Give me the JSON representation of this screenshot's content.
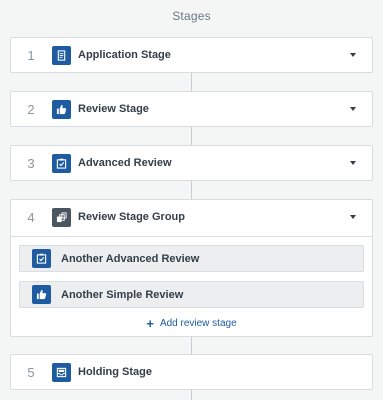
{
  "heading": "Stages",
  "colors": {
    "accent": "#1e5ba0",
    "group_icon_bg": "#4a5560",
    "page_bg": "#f4f5f5",
    "card_bg": "#ffffff",
    "sub_item_bg": "#eceeef"
  },
  "stages": [
    {
      "number": "1",
      "label": "Application Stage",
      "icon": "form-icon"
    },
    {
      "number": "2",
      "label": "Review Stage",
      "icon": "thumbs-up-icon"
    },
    {
      "number": "3",
      "label": "Advanced Review",
      "icon": "checkbox-icon"
    },
    {
      "number": "4",
      "label": "Review Stage Group",
      "icon": "group-icon",
      "sub_items": [
        {
          "label": "Another Advanced Review",
          "icon": "checkbox-icon"
        },
        {
          "label": "Another Simple Review",
          "icon": "thumbs-up-icon"
        }
      ],
      "add_label": "Add review stage",
      "add_icon": "plus-icon"
    },
    {
      "number": "5",
      "label": "Holding Stage",
      "icon": "inbox-icon"
    }
  ],
  "caret_icon": "caret-down-icon"
}
